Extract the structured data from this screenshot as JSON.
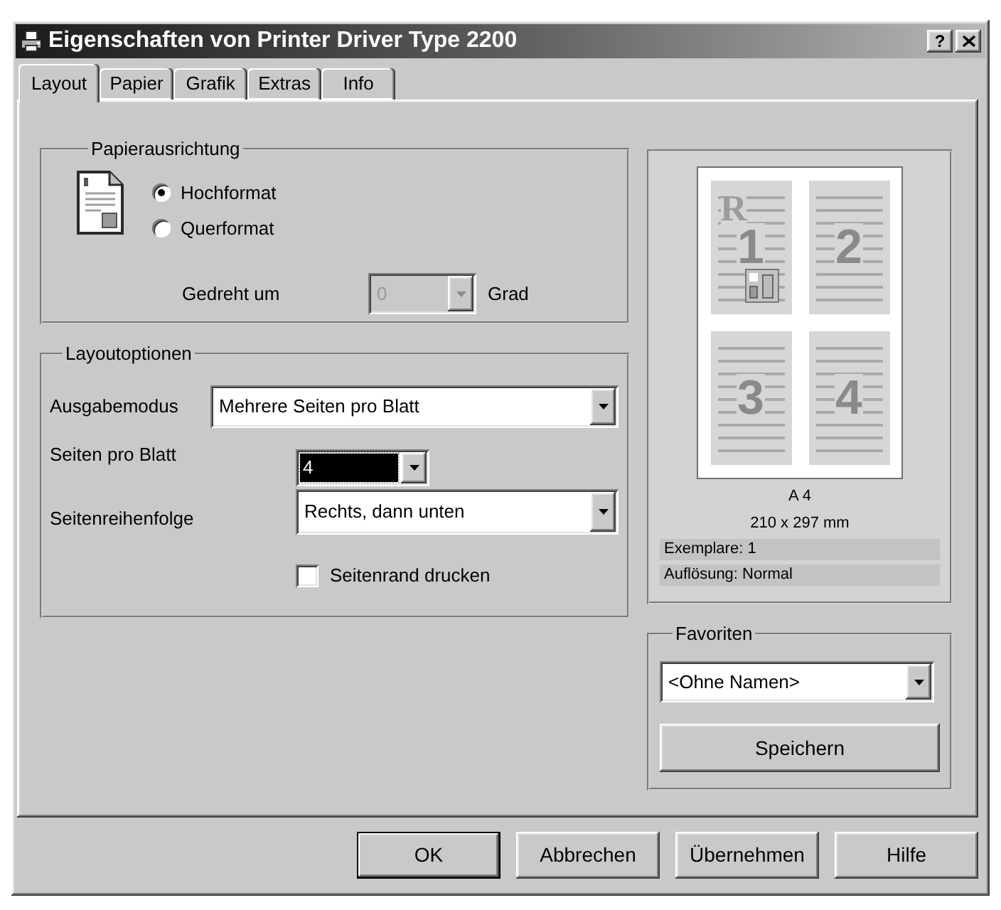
{
  "window": {
    "title": "Eigenschaften von Printer Driver Type 2200",
    "help_button": "?"
  },
  "tabs": [
    {
      "label": "Layout",
      "selected": true
    },
    {
      "label": "Papier",
      "selected": false
    },
    {
      "label": "Grafik",
      "selected": false
    },
    {
      "label": "Extras",
      "selected": false
    },
    {
      "label": "Info",
      "selected": false
    }
  ],
  "orientation": {
    "title": "Papierausrichtung",
    "options": [
      {
        "label": "Hochformat",
        "selected": true
      },
      {
        "label": "Querformat",
        "selected": false
      }
    ],
    "rotation": {
      "label": "Gedreht um",
      "value": "0",
      "disabled": true,
      "unit": "Grad"
    }
  },
  "layout_options": {
    "title": "Layoutoptionen",
    "output_mode": {
      "label": "Ausgabemodus",
      "value": "Mehrere Seiten pro Blatt"
    },
    "pages_per_sheet": {
      "label": "Seiten pro Blatt",
      "value": "4",
      "focused": true
    },
    "page_order": {
      "label": "Seitenreihenfolge",
      "value": "Rechts, dann unten"
    },
    "print_border": {
      "label": "Seitenrand drucken",
      "checked": false
    }
  },
  "preview": {
    "pages": [
      {
        "kind": "cover",
        "letter": "R",
        "number": "1"
      },
      {
        "kind": "plain",
        "number": "2"
      },
      {
        "kind": "plain",
        "number": "3"
      },
      {
        "kind": "plain",
        "number": "4"
      }
    ],
    "paper": "A 4",
    "size": "210 x 297 mm",
    "details": [
      "Exemplare: 1",
      "Auflösung: Normal"
    ]
  },
  "favorites": {
    "title": "Favoriten",
    "value": "<Ohne Namen>",
    "save_button": "Speichern"
  },
  "buttons": [
    {
      "label": "OK",
      "default": true
    },
    {
      "label": "Abbrechen",
      "default": false
    },
    {
      "label": "Übernehmen",
      "default": false
    },
    {
      "label": "Hilfe",
      "default": false
    }
  ]
}
